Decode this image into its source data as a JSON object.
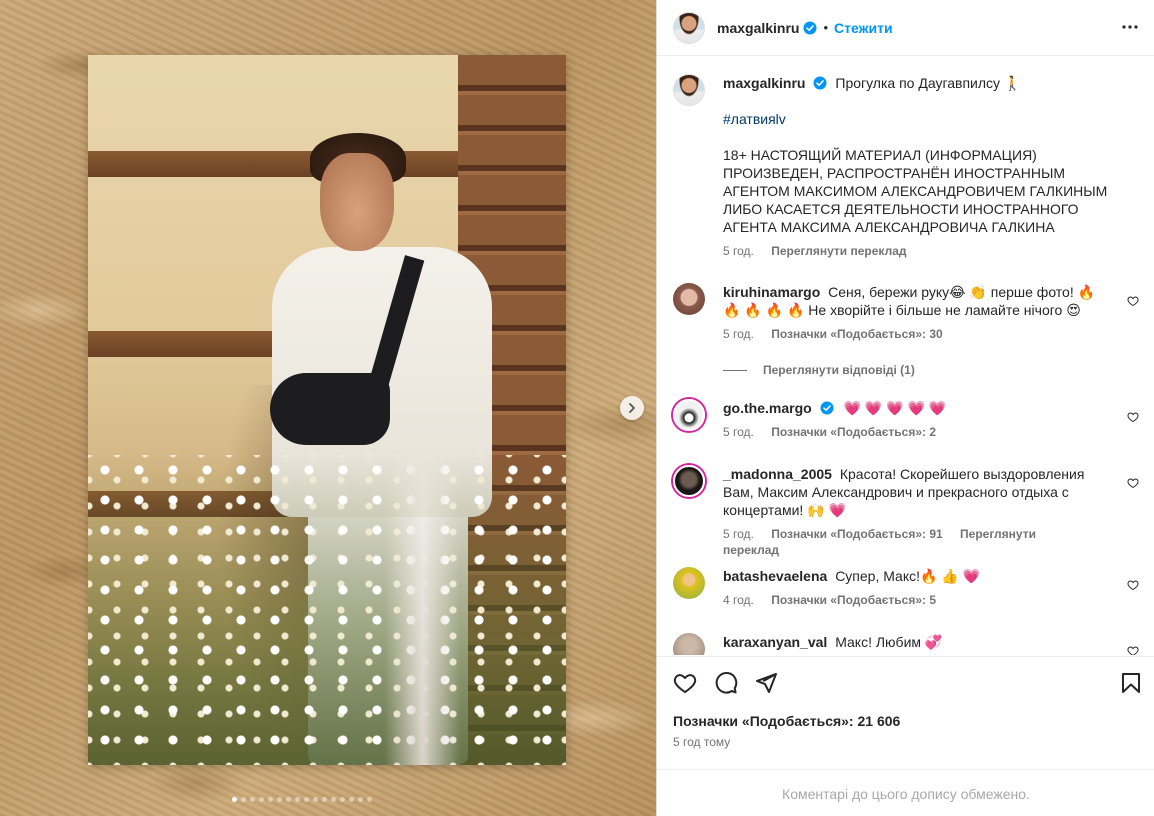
{
  "post": {
    "username": "maxgalkinru",
    "follow_label": "Стежити",
    "separator": "•",
    "more_icon": "more-horizontal-icon",
    "slides_total": 16,
    "slide_index": 1
  },
  "caption": {
    "username": "maxgalkinru",
    "text": "Прогулка по Даугавпилсу 🚶",
    "hashtag": "#латвияlv",
    "notice": "18+ НАСТОЯЩИЙ МАТЕРИАЛ (ИНФОРМАЦИЯ) ПРОИЗВЕДЕН, РАСПРОСТРАНЁН ИНОСТРАННЫМ АГЕНТОМ МАКСИМОМ АЛЕКСАНДРОВИЧЕМ ГАЛКИНЫМ ЛИБО КАСАЕТСЯ ДЕЯТЕЛЬНОСТИ ИНОСТРАННОГО АГЕНТА МАКСИМА АЛЕКСАНДРОВИЧА ГАЛКИНА",
    "time": "5 год.",
    "translate": "Переглянути переклад"
  },
  "comments": [
    {
      "username": "kiruhinamargo",
      "text": "Сеня, бережи руку😂 👏 перше фото! 🔥 🔥 🔥 🔥 🔥 Не хворійте і більше не ламайте нічого 😍",
      "time": "5 год.",
      "likes": "Позначки «Подобається»: 30",
      "view_replies": "Переглянути відповіді (1)"
    },
    {
      "username": "go.the.margo",
      "text": "💗 💗 💗 💗 💗",
      "time": "5 год.",
      "likes": "Позначки «Подобається»: 2"
    },
    {
      "username": "_madonna_2005",
      "text": "Красота! Скорейшего выздоровления Вам, Максим Александрович и прекрасного отдыха с концертами! 🙌 💗",
      "time": "5 год.",
      "likes": "Позначки «Подобається»: 91",
      "translate": "Переглянути переклад"
    },
    {
      "username": "batashevaelena",
      "text": "Супер, Макс!🔥 👍 💗",
      "time": "4 год.",
      "likes": "Позначки «Подобається»: 5"
    },
    {
      "username": "karaxanyan_val",
      "text": "Макс! Любим 💞"
    }
  ],
  "footer": {
    "likes_count": "Позначки «Подобається»: 21 606",
    "posted_ago": "5 год тому",
    "comments_limited": "Коментарі до цього допису обмежено."
  },
  "colors": {
    "accent": "#0095f6",
    "verified": "#0095f6",
    "secondary_text": "#737373",
    "hashtag": "#00376b"
  }
}
